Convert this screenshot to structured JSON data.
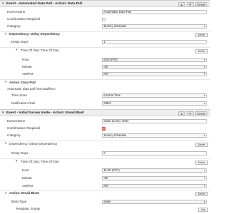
{
  "event1": {
    "title": "Event - Automated Data Pull - Action: Data Pull",
    "up": "▲",
    "down": "▼",
    "delete": "Delete",
    "fields": {
      "event_name_label": "Event Name",
      "event_name_value": "Automated Data Pull",
      "confirmation_label": "Confirmation Required",
      "category_label": "Category",
      "category_value": "Survey Schedule"
    },
    "dependency": {
      "title": "Dependency: Delay Dependency",
      "delete": "Delete",
      "delay_days_label": "Delay Days",
      "delay_days_value": "1"
    },
    "time_of_day": {
      "title": "Time Of Day: Time Of Day",
      "delete": "Delete",
      "hour_label": "Hour",
      "hour_value": "8:00 (PST)",
      "minute_label": "Minute",
      "minute_value": ":00",
      "ampm_label": "AM/PM",
      "ampm_value": "AM"
    },
    "action": {
      "title": "Action: Data Pull",
      "description": "Automatic data pull from Bullhorn",
      "time_zone_label": "Time Zone",
      "time_zone_value": "Central Time",
      "notification_label": "Notification Role",
      "notification_value": "Other"
    }
  },
  "event2": {
    "title": "Event - Initial Survey Invite - Action: Email Blast",
    "up": "▲",
    "down": "▼",
    "delete": "Delete",
    "fields": {
      "event_name_label": "Event Name",
      "event_name_value": "Initial Survey Invite",
      "confirmation_label": "Confirmation Required",
      "category_label": "Category",
      "category_value": "Survey Schedule"
    },
    "dependency": {
      "title": "Dependency: Delay Dependency",
      "delete": "Delete",
      "delay_days_label": "Delay Days",
      "delay_days_value": "0"
    },
    "time_of_day": {
      "title": "Time Of Day: Time Of Day",
      "delete": "Delete",
      "hour_label": "Hour",
      "hour_value": "11:00 (PST)",
      "minute_label": "Minute",
      "minute_value": ":00",
      "ampm_label": "AM/PM",
      "ampm_value": "AM"
    },
    "action": {
      "title": "Action: Email Blast",
      "delete": "Delete",
      "blast_type_label": "Blast Type",
      "blast_type_value": "Initial",
      "template_label": "Template:",
      "template_value": "Empty",
      "add": "Add"
    }
  },
  "icons": {
    "collapse": "chevron-down-icon",
    "dropdown": "dropdown-arrow-icon"
  }
}
